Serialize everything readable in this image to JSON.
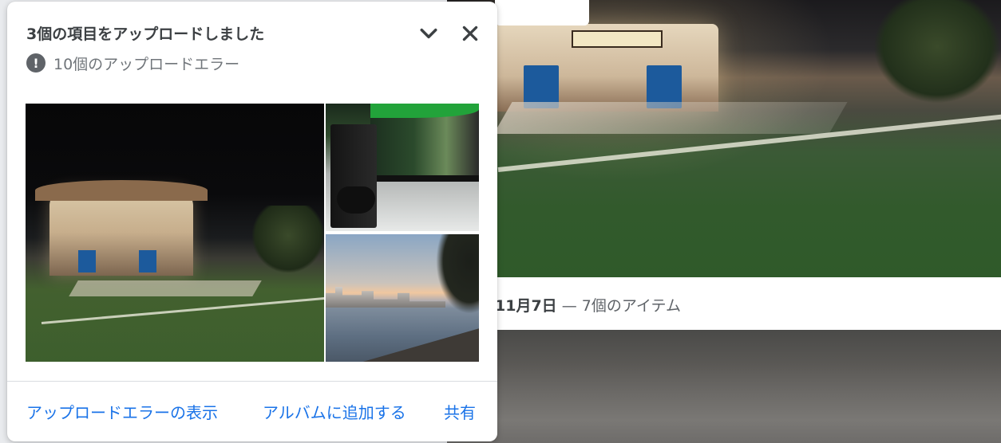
{
  "upload_panel": {
    "title": "3個の項目をアップロードしました",
    "error_summary": "10個のアップロードエラー",
    "thumbnails": [
      "night-theater-building",
      "xbox-console-controller",
      "sunset-waterfront"
    ],
    "actions": {
      "show_errors": "アップロードエラーの表示",
      "add_to_album": "アルバムに追加する",
      "share": "共有"
    }
  },
  "background": {
    "date_label": "11月7日",
    "item_count": " — 7個のアイテム"
  },
  "colors": {
    "accent": "#1a73e8",
    "text_primary": "#3c4043",
    "text_secondary": "#70757a"
  },
  "icons": {
    "collapse": "chevron-down-icon",
    "close": "close-icon",
    "error": "exclamation-circle-icon"
  }
}
